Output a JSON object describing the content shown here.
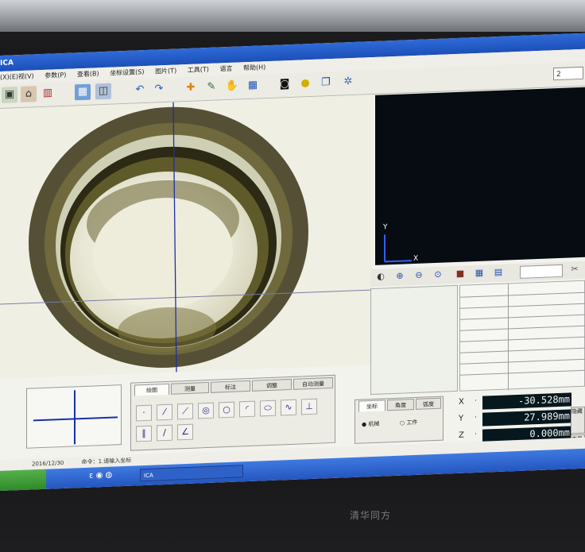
{
  "window": {
    "title": "ICA"
  },
  "menu": [
    "(X)(E)视(V)",
    "参数(P)",
    "查看(B)",
    "坐标设置(S)",
    "图片(T)",
    "工具(T)",
    "语言",
    "帮助(H)"
  ],
  "toolbar": {
    "icons": [
      "image-icon",
      "camera-setup-icon",
      "chart-icon",
      "grid-view-icon",
      "adjust-icon",
      "undo-icon",
      "redo-icon",
      "crosshair-icon",
      "pen-icon",
      "hand-icon",
      "table-icon",
      "camera-icon",
      "bulb-icon",
      "book-icon",
      "settings-icon"
    ],
    "zoom_value": "2"
  },
  "preview": {
    "y_label": "Y",
    "x_label": "X"
  },
  "drawing_tabs": [
    "绘图",
    "测量",
    "标注",
    "调整",
    "自动测量"
  ],
  "coordinate_panel": {
    "tabs": [
      "坐标",
      "角度",
      "弧度"
    ],
    "options": [
      "机械",
      "工件"
    ]
  },
  "readouts": [
    {
      "axis": "X",
      "value": "-30.528mm"
    },
    {
      "axis": "Y",
      "value": "27.989mm"
    },
    {
      "axis": "Z",
      "value": "0.000mm"
    }
  ],
  "side_buttons": [
    "隐藏",
    "查看"
  ],
  "status": {
    "date": "2016/12/30",
    "message": "命令：1.请输入坐标"
  },
  "taskbar": {
    "item": "ICA"
  },
  "monitor_brand": "清华同方"
}
